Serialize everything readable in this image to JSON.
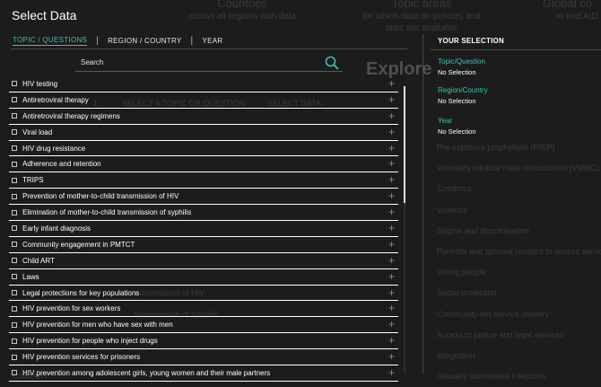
{
  "background": {
    "stats": [
      {
        "title": "Countries",
        "desc": [
          "across all regions with data"
        ]
      },
      {
        "title": "Topic areas",
        "desc": [
          "for which data on policies and",
          "laws are available"
        ]
      },
      {
        "title": "Global co",
        "desc": [
          "to end AID"
        ]
      }
    ],
    "explore_heading": "Explore",
    "filter_tabs": [
      "1",
      "SELECT A TOPIC OR QUESTION",
      "SELECT DATA"
    ],
    "topic_items": [
      "Pre-exposure prophylaxis (PrEP)",
      "Voluntary medical male circumcision (VMMC)",
      "Condoms",
      "Violence",
      "Stigma and discrimination",
      "Parental and spousal consent to access servic",
      "Young people",
      "Social protection",
      "Community-led service delivery",
      "Access to justice and legal services",
      "Integration",
      "Sexually transmitted infections"
    ],
    "left_items": [
      "Child ART",
      "transmission of HIV",
      "transmission of syphilis"
    ]
  },
  "modal": {
    "title": "Select Data",
    "tabs": [
      "TOPIC / QUESTIONS",
      "REGION / COUNTRY",
      "YEAR"
    ],
    "tab_separator": "|",
    "search": {
      "placeholder": "Search",
      "value": ""
    },
    "items": [
      "HIV testing",
      "Antiretroviral therapy",
      "Antiretroviral therapy regimens",
      "Viral load",
      "HIV drug resistance",
      "Adherence and retention",
      "TRIPS",
      "Prevention of mother-to-child transmission of HIV",
      "Elimination of mother-to-child transmission of syphilis",
      "Early infant diagnosis",
      "Community engagement in PMTCT",
      "Child ART",
      "Laws",
      "Legal protections for key populations",
      "HIV prevention for sex workers",
      "HIV prevention for men who have sex with men",
      "HIV prevention for people who inject drugs",
      "HIV prevention services for prisoners",
      "HIV prevention among adolescent girls, young women and their male partners"
    ],
    "selection": {
      "heading": "YOUR SELECTION",
      "groups": [
        {
          "label": "Topic/Question",
          "value": "No Selection"
        },
        {
          "label": "Region/Country",
          "value": "No Selection"
        },
        {
          "label": "Year",
          "value": "No Selection"
        }
      ]
    }
  },
  "colors": {
    "accent": "#3fc1b3",
    "overlay": "#1c1c1c",
    "text": "#ffffff"
  }
}
